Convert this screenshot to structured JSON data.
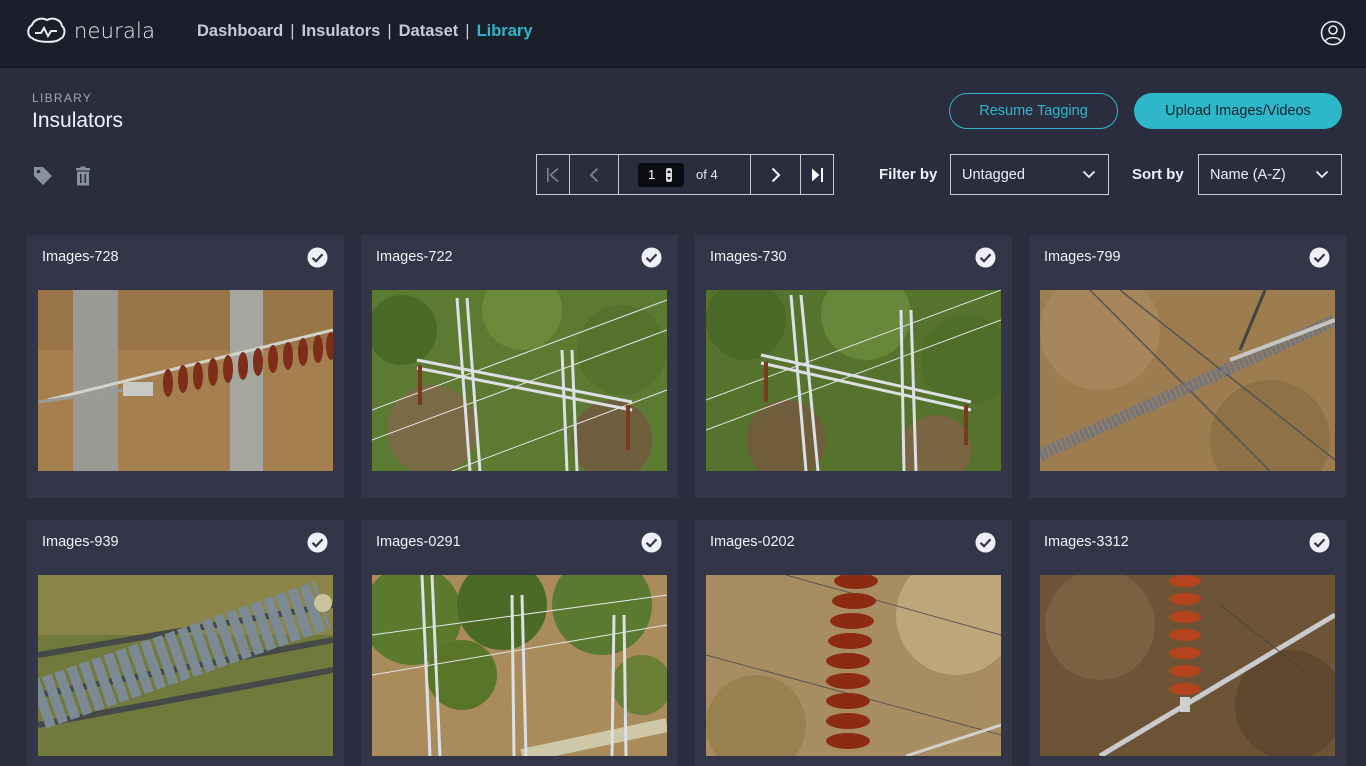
{
  "app": {
    "brand": "neurala"
  },
  "nav": {
    "items": [
      {
        "label": "Dashboard",
        "active": false
      },
      {
        "label": "Insulators",
        "active": false
      },
      {
        "label": "Dataset",
        "active": false
      },
      {
        "label": "Library",
        "active": true
      }
    ],
    "separator": "|"
  },
  "header": {
    "breadcrumb": "LIBRARY",
    "title": "Insulators",
    "resume_label": "Resume Tagging",
    "upload_label": "Upload Images/Videos"
  },
  "toolbar": {
    "tag_icon": "tag-icon",
    "delete_icon": "trash-icon"
  },
  "pagination": {
    "current_page": "1",
    "of_label": "of 4"
  },
  "filter": {
    "label": "Filter by",
    "value": "Untagged"
  },
  "sort": {
    "label": "Sort by",
    "value": "Name (A-Z)"
  },
  "colors": {
    "accent": "#2db7c9",
    "background": "#2a2d3e",
    "topbar": "#1b1e2b",
    "card": "#323648"
  },
  "cards": [
    {
      "title": "Images-728",
      "checked": true
    },
    {
      "title": "Images-722",
      "checked": true
    },
    {
      "title": "Images-730",
      "checked": true
    },
    {
      "title": "Images-799",
      "checked": true
    },
    {
      "title": "Images-939",
      "checked": true
    },
    {
      "title": "Images-0291",
      "checked": true
    },
    {
      "title": "Images-0202",
      "checked": true
    },
    {
      "title": "Images-3312",
      "checked": true
    }
  ]
}
